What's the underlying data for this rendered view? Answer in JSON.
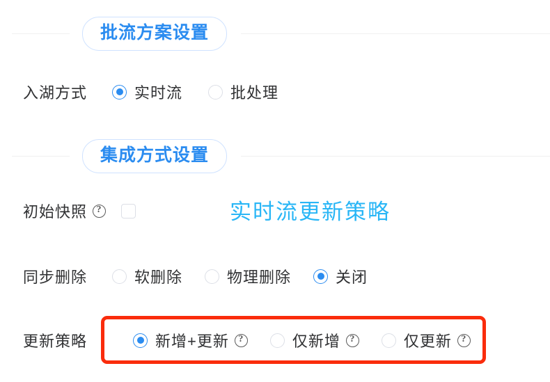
{
  "sections": [
    {
      "name": "batch-stream-plan",
      "title": "批流方案设置",
      "rows": [
        {
          "name": "ingest-mode",
          "label": "入湖方式",
          "type": "radio",
          "options": [
            {
              "label": "实时流",
              "selected": true,
              "help": false
            },
            {
              "label": "批处理",
              "selected": false,
              "help": false
            }
          ]
        }
      ]
    },
    {
      "name": "integration-mode",
      "title": "集成方式设置",
      "rows": [
        {
          "name": "initial-snapshot",
          "label": "初始快照",
          "label_help": "?",
          "type": "checkbox",
          "checked": false
        },
        {
          "name": "sync-delete",
          "label": "同步删除",
          "type": "radio",
          "options": [
            {
              "label": "软删除",
              "selected": false,
              "help": false
            },
            {
              "label": "物理删除",
              "selected": false,
              "help": false
            },
            {
              "label": "关闭",
              "selected": true,
              "help": false
            }
          ]
        },
        {
          "name": "update-strategy",
          "label": "更新策略",
          "type": "radio",
          "options": [
            {
              "label": "新增+更新",
              "selected": true,
              "help": true,
              "help_glyph": "?"
            },
            {
              "label": "仅新增",
              "selected": false,
              "help": true,
              "help_glyph": "?"
            },
            {
              "label": "仅更新",
              "selected": false,
              "help": true,
              "help_glyph": "?"
            }
          ]
        }
      ]
    }
  ],
  "annotation": {
    "text": "实时流更新策略",
    "color": "#29b6f6"
  },
  "highlight": {
    "name": "update-strategy-highlight",
    "color": "#fa2c0c"
  },
  "colors": {
    "accent_blue": "#2b8cf0",
    "pill_border": "#cfe2ff",
    "divider": "#f0f0f0",
    "text": "#303133",
    "radio_off_border": "#dcdfe6"
  }
}
